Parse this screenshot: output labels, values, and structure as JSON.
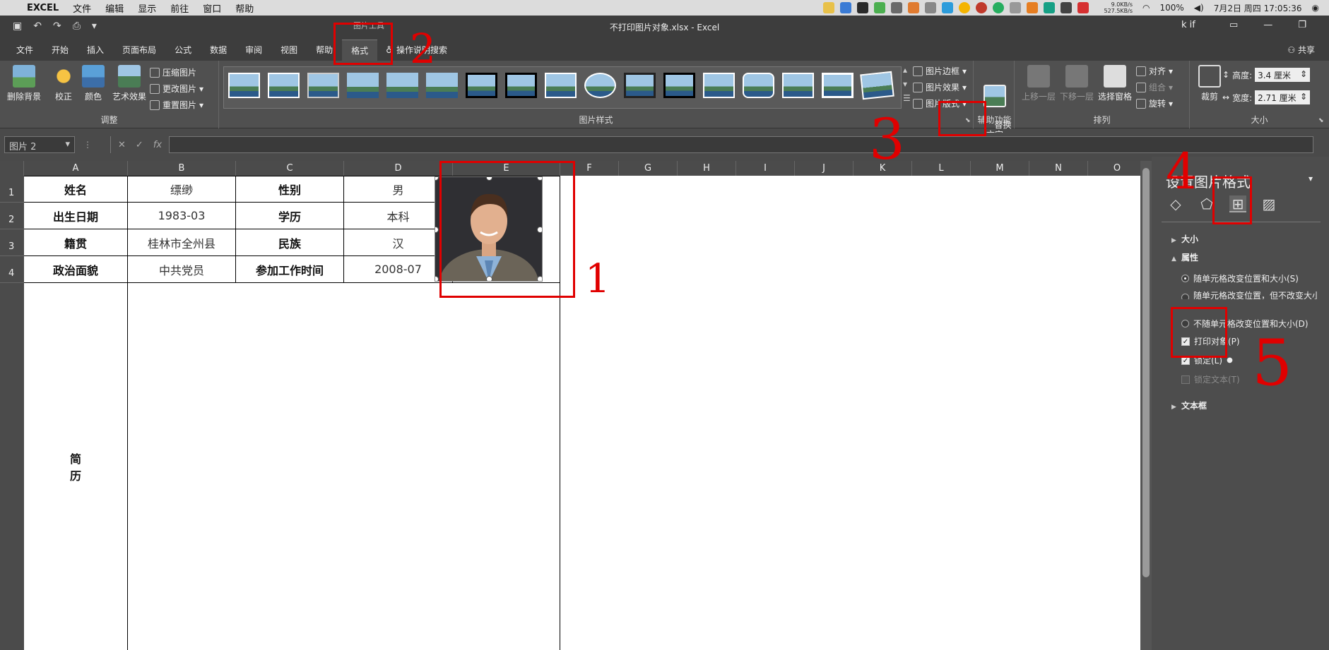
{
  "menubar": {
    "app": "EXCEL",
    "items": [
      "文件",
      "编辑",
      "显示",
      "前往",
      "窗口",
      "帮助"
    ],
    "network": "9.0KB/s\n527.5KB/s",
    "battery": "100%",
    "datetime": "7月2日 周四 17:05:36"
  },
  "titlebar": {
    "doc_title": "不打印图片对象.xlsx  -  Excel",
    "context_label": "图片工具",
    "user": "k if"
  },
  "tabs": {
    "items": [
      "文件",
      "开始",
      "插入",
      "页面布局",
      "公式",
      "数据",
      "审阅",
      "视图",
      "帮助",
      "格式"
    ],
    "active": "格式",
    "tell_me": "操作说明搜索",
    "share": "共享"
  },
  "ribbon": {
    "adjust": {
      "remove_bg": "删除背景",
      "correct": "校正",
      "color": "颜色",
      "art": "艺术效果",
      "compress": "压缩图片",
      "change": "更改图片",
      "reset": "重置图片",
      "label": "调整"
    },
    "styles": {
      "border": "图片边框",
      "effects": "图片效果",
      "layout": "图片版式",
      "label": "图片样式"
    },
    "access": {
      "alt_text": "替换\n文字",
      "label": "辅助功能"
    },
    "arrange": {
      "forward": "上移一层",
      "backward": "下移一层",
      "selection": "选择窗格",
      "align": "对齐",
      "group": "组合",
      "rotate": "旋转",
      "label": "排列"
    },
    "size": {
      "crop": "裁剪",
      "height_label": "高度:",
      "height_value": "3.4 厘米",
      "width_label": "宽度:",
      "width_value": "2.71 厘米",
      "label": "大小"
    }
  },
  "formulabar": {
    "name_box": "图片 2",
    "fx": "fx"
  },
  "sheet": {
    "columns": [
      "A",
      "B",
      "C",
      "D",
      "E",
      "F",
      "G",
      "H",
      "I",
      "J",
      "K",
      "L",
      "M",
      "N",
      "O"
    ],
    "rows": [
      "1",
      "2",
      "3",
      "4"
    ],
    "cells": {
      "r1": [
        "姓名",
        "缥缈",
        "性别",
        "男"
      ],
      "r2": [
        "出生日期",
        "1983-03",
        "学历",
        "本科"
      ],
      "r3": [
        "籍贯",
        "桂林市全州县",
        "民族",
        "汉"
      ],
      "r4": [
        "政治面貌",
        "中共党员",
        "参加工作时间",
        "2008-07"
      ],
      "resume": "简\n历"
    }
  },
  "pane": {
    "title": "设置图片格式",
    "size_section": "大小",
    "props_section": "属性",
    "opt_move_size": "随单元格改变位置和大小(S)",
    "opt_move_only": "随单元格改变位置，但不改变大小(M)",
    "opt_none": "不随单元格改变位置和大小(D)",
    "print_object": "打印对象(P)",
    "locked": "锁定(L)",
    "lock_text": "锁定文本(T)",
    "textbox_section": "文本框"
  },
  "annotations": [
    "1",
    "2",
    "3",
    "4",
    "5"
  ],
  "colors": {
    "annotation": "#e00000",
    "ribbon": "#505050",
    "pane": "#4d4d4d"
  }
}
